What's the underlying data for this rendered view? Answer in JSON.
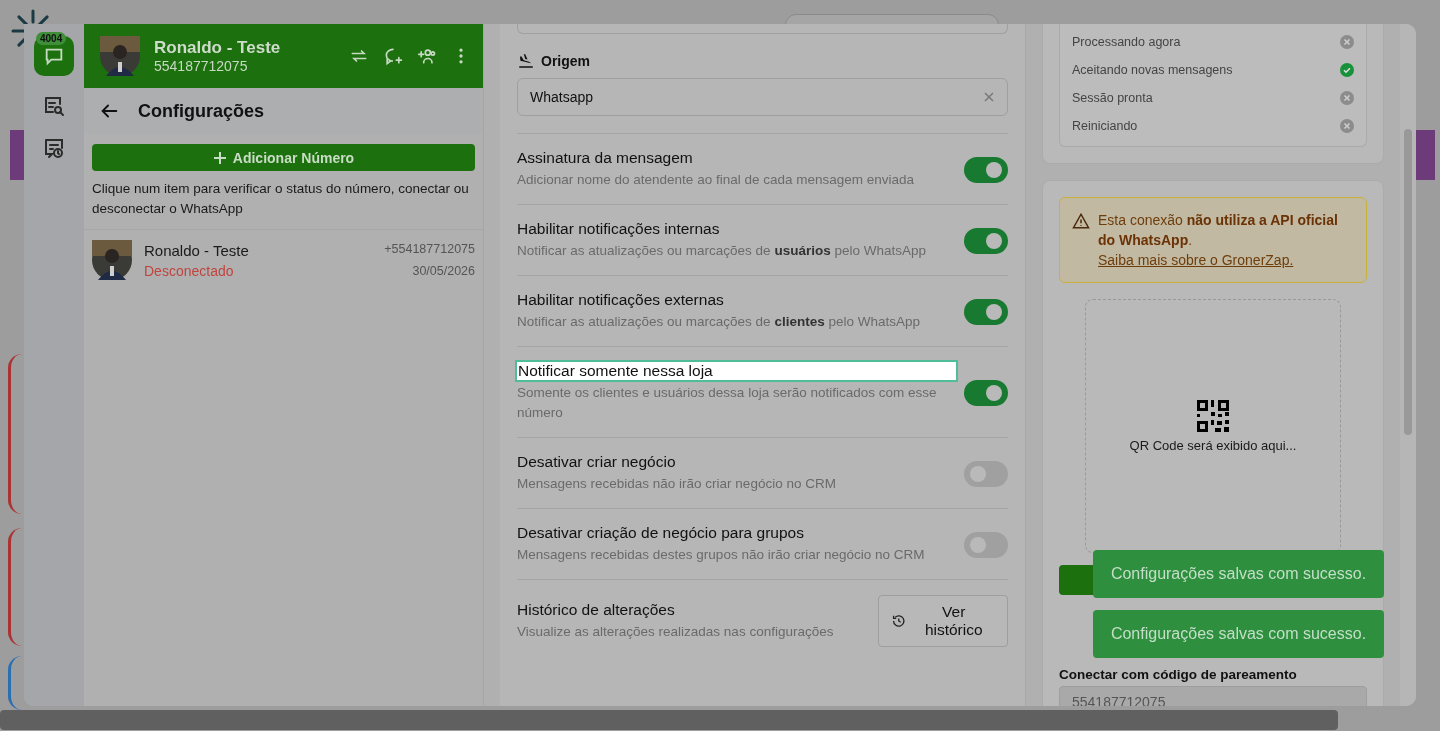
{
  "rail": {
    "badge": "4004"
  },
  "header": {
    "name": "Ronaldo - Teste",
    "phone": "554187712075"
  },
  "panel": {
    "title": "Configurações",
    "add_button": "Adicionar Número",
    "hint": "Clique num item para verificar o status do número, conectar ou desconectar o WhatsApp",
    "numbers": [
      {
        "name": "Ronaldo - Teste",
        "status": "Desconectado",
        "connected": false,
        "phone": "+554187712075",
        "date": "30/05/2026"
      }
    ]
  },
  "settings": {
    "origin_label": "Origem",
    "origin_value": "Whatsapp",
    "items": [
      {
        "kind": "toggle",
        "title": "Assinatura da mensagem",
        "description": "Adicionar nome do atendente ao final de cada mensagem enviada",
        "on": true,
        "highlighted": false
      },
      {
        "kind": "toggle",
        "title": "Habilitar notificações internas",
        "description": "Notificar as atualizações ou marcações de **usuários** pelo WhatsApp",
        "on": true,
        "highlighted": false
      },
      {
        "kind": "toggle",
        "title": "Habilitar notificações externas",
        "description": "Notificar as atualizações ou marcações de **clientes** pelo WhatsApp",
        "on": true,
        "highlighted": false
      },
      {
        "kind": "toggle",
        "title": "Notificar somente nessa loja",
        "description": "Somente os clientes e usuários dessa loja serão notificados com esse número",
        "on": true,
        "highlighted": true
      },
      {
        "kind": "toggle",
        "title": "Desativar criar negócio",
        "description": "Mensagens recebidas não irão criar negócio no CRM",
        "on": false,
        "highlighted": false
      },
      {
        "kind": "toggle",
        "title": "Desativar criação de negócio para grupos",
        "description": "Mensagens recebidas destes grupos não irão criar negócio no CRM",
        "on": false,
        "highlighted": false
      },
      {
        "kind": "button",
        "title": "Histórico de alterações",
        "description": "Visualize as alterações realizadas nas configurações",
        "button": "Ver histórico"
      }
    ]
  },
  "status": [
    {
      "label": "Processando agora",
      "ok": false
    },
    {
      "label": "Aceitando novas mensagens",
      "ok": true
    },
    {
      "label": "Sessão pronta",
      "ok": false
    },
    {
      "label": "Reiniciando",
      "ok": false
    }
  ],
  "warning": {
    "text": "Esta conexão **não utiliza a API oficial do WhatsApp**.",
    "link": "Saiba mais sobre o GronerZap."
  },
  "qr": {
    "placeholder": "QR Code será exibido aqui..."
  },
  "pairing": {
    "label": "Conectar com código de pareamento",
    "value": "554187712075"
  },
  "toasts": [
    "Configurações salvas com sucesso.",
    "Configurações salvas com sucesso."
  ]
}
